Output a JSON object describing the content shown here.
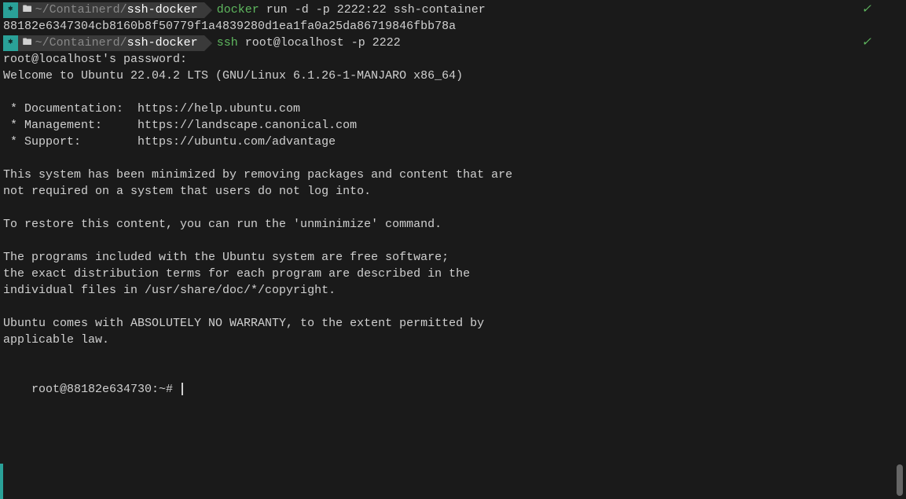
{
  "prompt1": {
    "badge": "⎈",
    "folder_icon": "🖿",
    "path_prefix": "~/Containerd/",
    "path_current": "ssh-docker",
    "command_exe": "docker",
    "command_args": " run -d -p 2222:22 ssh-container",
    "checkmark": "✓"
  },
  "output1": {
    "hash": "88182e6347304cb8160b8f50779f1a4839280d1ea1fa0a25da86719846fbb78a"
  },
  "prompt2": {
    "badge": "⎈",
    "folder_icon": "🖿",
    "path_prefix": "~/Containerd/",
    "path_current": "ssh-docker",
    "command_exe": "ssh",
    "command_args": " root@localhost -p 2222",
    "checkmark": "✓"
  },
  "motd": {
    "line1": "root@localhost's password:",
    "line2": "Welcome to Ubuntu 22.04.2 LTS (GNU/Linux 6.1.26-1-MANJARO x86_64)",
    "line3": " * Documentation:  https://help.ubuntu.com",
    "line4": " * Management:     https://landscape.canonical.com",
    "line5": " * Support:        https://ubuntu.com/advantage",
    "line6": "This system has been minimized by removing packages and content that are",
    "line7": "not required on a system that users do not log into.",
    "line8": "To restore this content, you can run the 'unminimize' command.",
    "line9": "The programs included with the Ubuntu system are free software;",
    "line10": "the exact distribution terms for each program are described in the",
    "line11": "individual files in /usr/share/doc/*/copyright.",
    "line12": "Ubuntu comes with ABSOLUTELY NO WARRANTY, to the extent permitted by",
    "line13": "applicable law."
  },
  "shell_prompt": {
    "text": "root@88182e634730:~# "
  }
}
